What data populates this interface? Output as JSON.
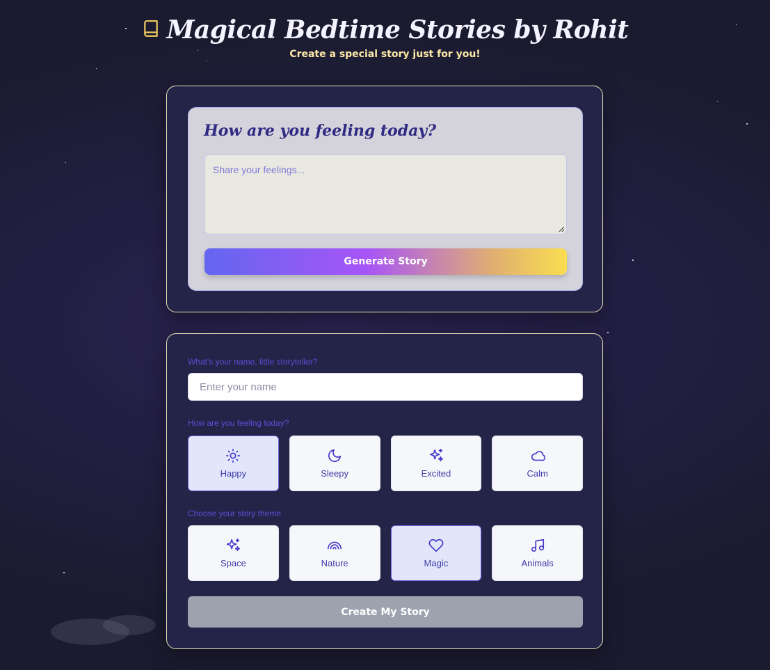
{
  "header": {
    "title": "Magical Bedtime Stories by Rohit",
    "subtitle": "Create a special story just for you!"
  },
  "feeling_panel": {
    "heading": "How are you feeling today?",
    "placeholder": "Share your feelings...",
    "generate_label": "Generate Story"
  },
  "form": {
    "name_label": "What's your name, little storyteller?",
    "name_placeholder": "Enter your name",
    "mood_label": "How are you feeling today?",
    "moods": [
      {
        "label": "Happy",
        "icon": "sun-icon",
        "selected": true
      },
      {
        "label": "Sleepy",
        "icon": "moon-icon",
        "selected": false
      },
      {
        "label": "Excited",
        "icon": "sparkles-icon",
        "selected": false
      },
      {
        "label": "Calm",
        "icon": "cloud-icon",
        "selected": false
      }
    ],
    "theme_label": "Choose your story theme",
    "themes": [
      {
        "label": "Space",
        "icon": "sparkles-icon",
        "selected": false
      },
      {
        "label": "Nature",
        "icon": "rainbow-icon",
        "selected": false
      },
      {
        "label": "Magic",
        "icon": "heart-icon",
        "selected": true
      },
      {
        "label": "Animals",
        "icon": "music-note-icon",
        "selected": false
      }
    ],
    "create_label": "Create My Story"
  },
  "colors": {
    "accent": "#5a4fd6",
    "title_text": "#f4f3ff",
    "subtitle_text": "#fde9a8",
    "button_disabled": "#9ca3af",
    "gradient_start": "#6366f1",
    "gradient_mid": "#a855f7",
    "gradient_end": "#fadd50"
  }
}
